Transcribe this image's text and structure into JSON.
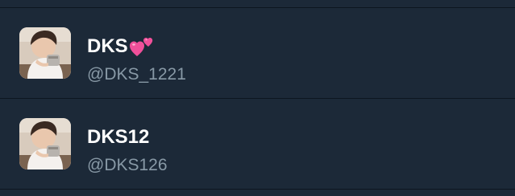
{
  "accounts": [
    {
      "display_name": "DKS",
      "name_emoji": "two-hearts-icon",
      "handle": "@DKS_1221",
      "avatar": "user-avatar"
    },
    {
      "display_name": "DKS12",
      "handle": "@DKS126",
      "avatar": "user-avatar"
    }
  ],
  "colors": {
    "background": "#1c2938",
    "divider": "#0d1620",
    "name_text": "#ffffff",
    "handle_text": "#8899a6",
    "emoji_pink": "#f0509a"
  }
}
